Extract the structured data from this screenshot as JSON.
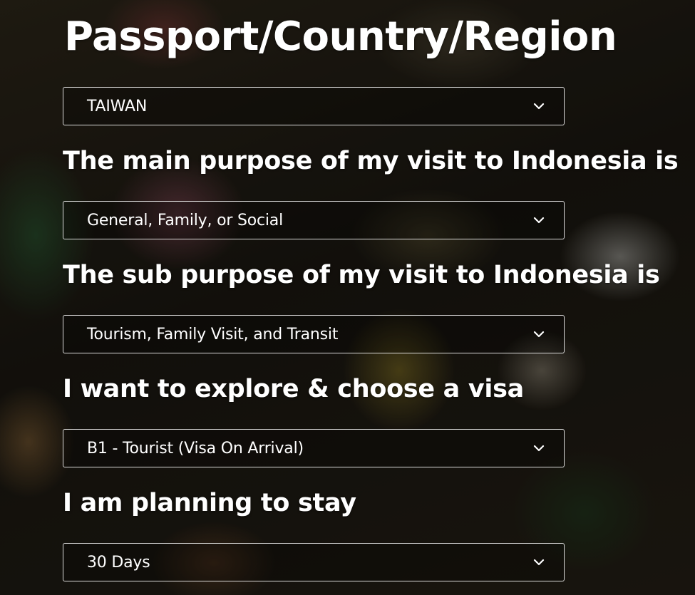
{
  "page": {
    "title": "Passport/Country/Region"
  },
  "form": {
    "passport": {
      "value": "TAIWAN",
      "icon": "chevron-down-icon"
    },
    "main_purpose": {
      "label": "The main purpose of my visit to Indonesia is",
      "value": "General, Family, or Social",
      "icon": "chevron-down-icon"
    },
    "sub_purpose": {
      "label": "The sub purpose of my visit to Indonesia is",
      "value": "Tourism, Family Visit, and Transit",
      "icon": "chevron-down-icon"
    },
    "visa": {
      "label": "I want to explore & choose a visa",
      "value": "B1 - Tourist (Visa On Arrival)",
      "icon": "chevron-down-icon"
    },
    "stay": {
      "label": "I am planning to stay",
      "value": "30 Days",
      "icon": "chevron-down-icon"
    }
  },
  "colors": {
    "text": "#ffffff",
    "border": "#ffffff"
  }
}
